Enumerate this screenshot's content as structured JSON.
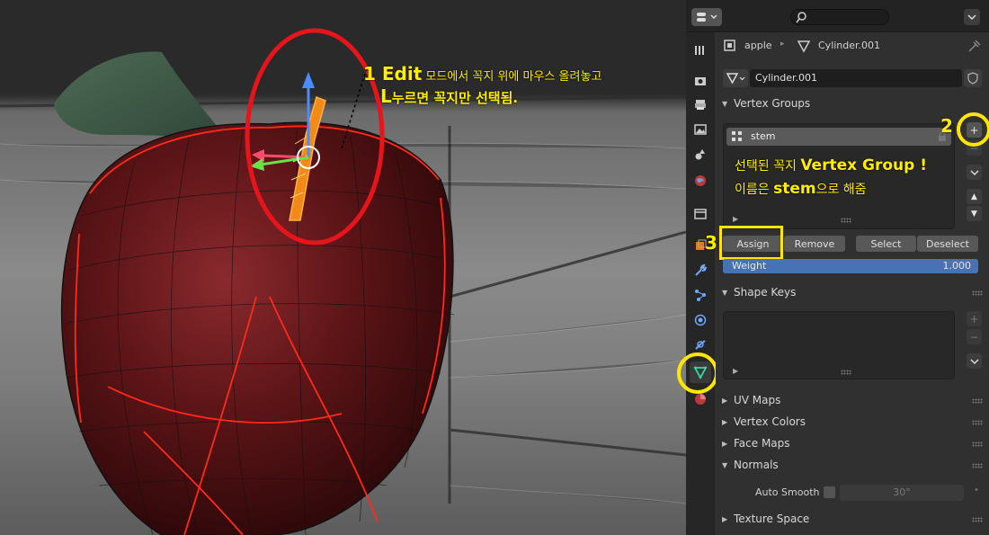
{
  "annotations": {
    "step1_number": "1",
    "step1_edit": "Edit",
    "step1_line1": " 모드에서 꼭지 위에 마우스 올려놓고",
    "step1_key": "L",
    "step1_line2": "누르면 꼭지만 선택됨.",
    "step2_number": "2",
    "step3_number": "3",
    "note_line1_a": "선택된 꼭지 ",
    "note_line1_b": "Vertex Group !",
    "note_line2_a": "이름은 ",
    "note_line2_b": "stem",
    "note_line2_c": "으로 해줌"
  },
  "header": {
    "search_placeholder": ""
  },
  "breadcrumb": {
    "object": "apple",
    "data": "Cylinder.001"
  },
  "mesh_datablock": {
    "name": "Cylinder.001"
  },
  "vertex_groups": {
    "title": "Vertex Groups",
    "items": [
      "stem"
    ],
    "assign_label": "Assign",
    "remove_label": "Remove",
    "select_label": "Select",
    "deselect_label": "Deselect",
    "weight_label": "Weight",
    "weight_value": "1.000",
    "weight_fraction": 1.0
  },
  "shape_keys": {
    "title": "Shape Keys"
  },
  "collapsed_panels": [
    "UV Maps",
    "Vertex Colors",
    "Face Maps"
  ],
  "normals": {
    "title": "Normals",
    "auto_smooth_label": "Auto Smooth",
    "angle_value": "30°"
  },
  "texture_space": {
    "title": "Texture Space"
  },
  "colors": {
    "accent_blue": "#4772b3",
    "annotation_yellow": "#ffe600",
    "annotation_red": "#e8141c",
    "active_tab_green": "#3fd4a2"
  }
}
